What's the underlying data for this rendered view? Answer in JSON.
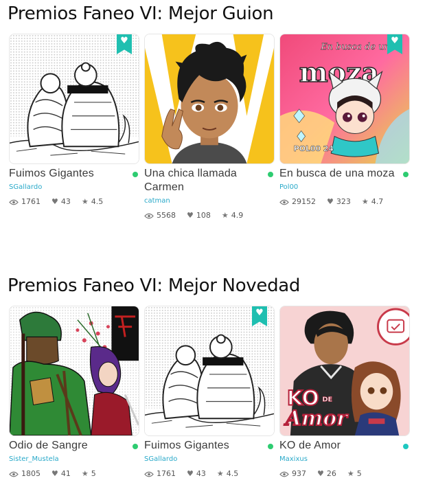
{
  "colors": {
    "accent": "#1fbfb0",
    "online_dot": "#2ecc71",
    "author_link": "#29a9c9"
  },
  "sections": [
    {
      "title": "Premios Faneo VI: Mejor Guion",
      "cards": [
        {
          "title": "Fuimos Gigantes",
          "author": "SGallardo",
          "views": "1761",
          "likes": "43",
          "rating": "4.5",
          "bookmarked": true,
          "dot_color": "#2ecc71"
        },
        {
          "title": "Una chica llamada Carmen",
          "author": "catman",
          "views": "5568",
          "likes": "108",
          "rating": "4.9",
          "bookmarked": false,
          "dot_color": "#2ecc71"
        },
        {
          "title": "En busca de una moza",
          "author": "Pol00",
          "views": "29152",
          "likes": "323",
          "rating": "4.7",
          "bookmarked": true,
          "dot_color": "#2ecc71"
        }
      ]
    },
    {
      "title": "Premios Faneo VI: Mejor Novedad",
      "cards": [
        {
          "title": "Odio de Sangre",
          "author": "Sister_Mustela",
          "views": "1805",
          "likes": "41",
          "rating": "5",
          "bookmarked": false,
          "dot_color": "#2ecc71"
        },
        {
          "title": "Fuimos Gigantes",
          "author": "SGallardo",
          "views": "1761",
          "likes": "43",
          "rating": "4.5",
          "bookmarked": true,
          "dot_color": "#2ecc71"
        },
        {
          "title": "KO de Amor",
          "author": "Maxixus",
          "views": "937",
          "likes": "26",
          "rating": "5",
          "bookmarked": false,
          "dot_color": "#1fc8c0"
        }
      ]
    }
  ],
  "cover_texts": {
    "moza_top": "En busca de una",
    "moza_main": "moza",
    "moza_sign": "POL00 24",
    "ko_top": "KO",
    "ko_de": "DE",
    "ko_amor": "Amor"
  },
  "icons": {
    "bookmark": "heart-bookmark-icon",
    "views": "eye-icon",
    "likes": "heart-icon",
    "rating": "star-icon"
  }
}
